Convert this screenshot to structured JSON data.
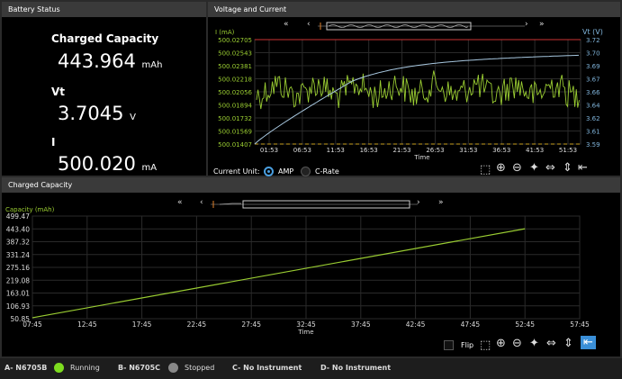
{
  "battery": {
    "title": "Battery Status",
    "charged_label": "Charged Capacity",
    "charged_value": "443.964",
    "charged_unit": "mAh",
    "vt_label": "Vt",
    "vt_value": "3.7045",
    "vt_unit": "V",
    "i_label": "I",
    "i_value": "500.020",
    "i_unit": "mA"
  },
  "vc": {
    "title": "Voltage and Current",
    "left_axis_label": "I (mA)",
    "right_axis_label": "Vt (V)",
    "left_ticks": [
      "500.02705",
      "500.02543",
      "500.02381",
      "500.02218",
      "500.02056",
      "500.01894",
      "500.01732",
      "500.01569",
      "500.01407"
    ],
    "right_ticks": [
      "3.72",
      "3.70",
      "3.69",
      "3.67",
      "3.66",
      "3.64",
      "3.62",
      "3.61",
      "3.59"
    ],
    "x_ticks": [
      "01:53",
      "06:53",
      "11:53",
      "16:53",
      "21:53",
      "26:53",
      "31:53",
      "36:53",
      "41:53",
      "51:53"
    ],
    "x_label": "Time",
    "current_unit_label": "Current Unit:",
    "amp_label": "AMP",
    "crate_label": "C-Rate",
    "nav_prev2": "«",
    "nav_prev": "‹",
    "nav_next": "›",
    "nav_next2": "»",
    "colors": {
      "current": "#9acd32",
      "voltage": "#a8c8e0",
      "limit": "#cc3333"
    }
  },
  "cc": {
    "title": "Charged Capacity",
    "y_label": "Capacity (mAh)",
    "y_ticks": [
      "499.47",
      "443.40",
      "387.32",
      "331.24",
      "275.16",
      "219.08",
      "163.01",
      "106.93",
      "50.85"
    ],
    "x_ticks": [
      "07:45",
      "12:45",
      "17:45",
      "22:45",
      "27:45",
      "32:45",
      "37:45",
      "42:45",
      "47:45",
      "52:45",
      "57:45"
    ],
    "x_label": "Time",
    "flip_label": "Flip",
    "nav_prev2": "«",
    "nav_prev": "‹",
    "nav_next": "›",
    "nav_next2": "»",
    "line_color": "#9acd32"
  },
  "chart_data": [
    {
      "type": "line",
      "xlabel": "Time",
      "ylabel": "Capacity (mAh)",
      "ylim": [
        50.85,
        499.47
      ],
      "x": [
        "07:45",
        "52:45"
      ],
      "values": [
        55.0,
        443.96
      ],
      "grid": true
    }
  ],
  "status": {
    "a_label": "A- N6705B",
    "a_state": "Running",
    "b_label": "B- N6705C",
    "b_state": "Stopped",
    "c_label": "C- No Instrument",
    "d_label": "D- No Instrument",
    "running_color": "#7ddc1f",
    "stopped_color": "#888888"
  }
}
